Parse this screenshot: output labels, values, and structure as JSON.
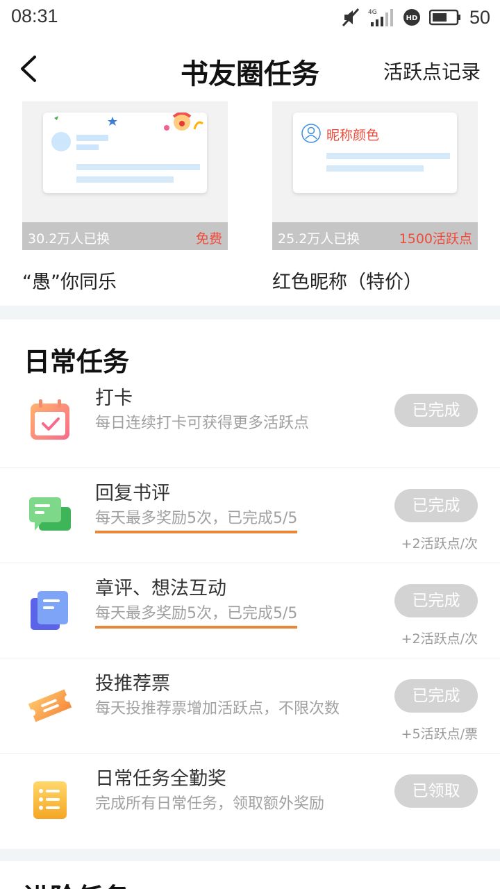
{
  "status_bar": {
    "time": "08:31",
    "network": "4G",
    "battery": "50"
  },
  "header": {
    "title": "书友圈任务",
    "record_link": "活跃点记录"
  },
  "promos": [
    {
      "count": "30.2万人已换",
      "price": "免费",
      "name": "“愚”你同乐"
    },
    {
      "count": "25.2万人已换",
      "price": "1500活跃点",
      "name": "红色昵称（特价）",
      "card_text": "昵称颜色"
    }
  ],
  "daily": {
    "title": "日常任务",
    "tasks": [
      {
        "title": "打卡",
        "desc": "每日连续打卡可获得更多活跃点",
        "button": "已完成",
        "reward": ""
      },
      {
        "title": "回复书评",
        "desc": "每天最多奖励5次，已完成5/5",
        "button": "已完成",
        "reward": "+2活跃点/次"
      },
      {
        "title": "章评、想法互动",
        "desc": "每天最多奖励5次，已完成5/5",
        "button": "已完成",
        "reward": "+2活跃点/次"
      },
      {
        "title": "投推荐票",
        "desc": "每天投推荐票增加活跃点，不限次数",
        "button": "已完成",
        "reward": "+5活跃点/票"
      },
      {
        "title": "日常任务全勤奖",
        "desc": "完成所有日常任务，领取额外奖励",
        "button": "已领取",
        "reward": ""
      }
    ]
  },
  "next_section_title": "进阶任务",
  "colors": {
    "accent_red": "#f04a3a",
    "underline_orange": "#e8873a",
    "done_button": "#d3d3d3"
  }
}
